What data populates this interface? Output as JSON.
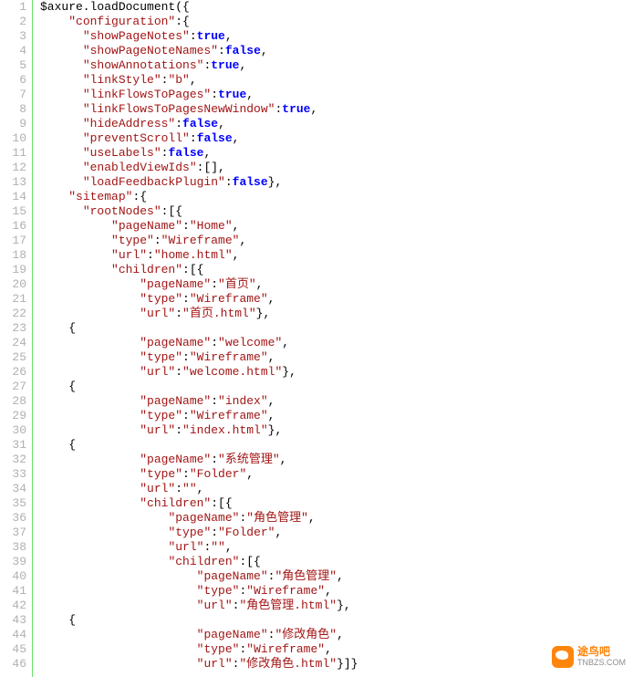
{
  "lineCount": 46,
  "code": [
    [
      [
        "plain",
        "$axure.loadDocument"
      ],
      [
        "punc",
        "({"
      ]
    ],
    [
      [
        "plain",
        "    "
      ],
      [
        "key",
        "\"configuration\""
      ],
      [
        "punc",
        ":{"
      ]
    ],
    [
      [
        "plain",
        "      "
      ],
      [
        "key",
        "\"showPageNotes\""
      ],
      [
        "punc",
        ":"
      ],
      [
        "bool",
        "true"
      ],
      [
        "punc",
        ","
      ]
    ],
    [
      [
        "plain",
        "      "
      ],
      [
        "key",
        "\"showPageNoteNames\""
      ],
      [
        "punc",
        ":"
      ],
      [
        "bool",
        "false"
      ],
      [
        "punc",
        ","
      ]
    ],
    [
      [
        "plain",
        "      "
      ],
      [
        "key",
        "\"showAnnotations\""
      ],
      [
        "punc",
        ":"
      ],
      [
        "bool",
        "true"
      ],
      [
        "punc",
        ","
      ]
    ],
    [
      [
        "plain",
        "      "
      ],
      [
        "key",
        "\"linkStyle\""
      ],
      [
        "punc",
        ":"
      ],
      [
        "str",
        "\"b\""
      ],
      [
        "punc",
        ","
      ]
    ],
    [
      [
        "plain",
        "      "
      ],
      [
        "key",
        "\"linkFlowsToPages\""
      ],
      [
        "punc",
        ":"
      ],
      [
        "bool",
        "true"
      ],
      [
        "punc",
        ","
      ]
    ],
    [
      [
        "plain",
        "      "
      ],
      [
        "key",
        "\"linkFlowsToPagesNewWindow\""
      ],
      [
        "punc",
        ":"
      ],
      [
        "bool",
        "true"
      ],
      [
        "punc",
        ","
      ]
    ],
    [
      [
        "plain",
        "      "
      ],
      [
        "key",
        "\"hideAddress\""
      ],
      [
        "punc",
        ":"
      ],
      [
        "bool",
        "false"
      ],
      [
        "punc",
        ","
      ]
    ],
    [
      [
        "plain",
        "      "
      ],
      [
        "key",
        "\"preventScroll\""
      ],
      [
        "punc",
        ":"
      ],
      [
        "bool",
        "false"
      ],
      [
        "punc",
        ","
      ]
    ],
    [
      [
        "plain",
        "      "
      ],
      [
        "key",
        "\"useLabels\""
      ],
      [
        "punc",
        ":"
      ],
      [
        "bool",
        "false"
      ],
      [
        "punc",
        ","
      ]
    ],
    [
      [
        "plain",
        "      "
      ],
      [
        "key",
        "\"enabledViewIds\""
      ],
      [
        "punc",
        ":[],"
      ]
    ],
    [
      [
        "plain",
        "      "
      ],
      [
        "key",
        "\"loadFeedbackPlugin\""
      ],
      [
        "punc",
        ":"
      ],
      [
        "bool",
        "false"
      ],
      [
        "punc",
        "},"
      ]
    ],
    [
      [
        "plain",
        "    "
      ],
      [
        "key",
        "\"sitemap\""
      ],
      [
        "punc",
        ":{"
      ]
    ],
    [
      [
        "plain",
        "      "
      ],
      [
        "key",
        "\"rootNodes\""
      ],
      [
        "punc",
        ":[{"
      ]
    ],
    [
      [
        "plain",
        "          "
      ],
      [
        "key",
        "\"pageName\""
      ],
      [
        "punc",
        ":"
      ],
      [
        "str",
        "\"Home\""
      ],
      [
        "punc",
        ","
      ]
    ],
    [
      [
        "plain",
        "          "
      ],
      [
        "key",
        "\"type\""
      ],
      [
        "punc",
        ":"
      ],
      [
        "str",
        "\"Wireframe\""
      ],
      [
        "punc",
        ","
      ]
    ],
    [
      [
        "plain",
        "          "
      ],
      [
        "key",
        "\"url\""
      ],
      [
        "punc",
        ":"
      ],
      [
        "str",
        "\"home.html\""
      ],
      [
        "punc",
        ","
      ]
    ],
    [
      [
        "plain",
        "          "
      ],
      [
        "key",
        "\"children\""
      ],
      [
        "punc",
        ":[{"
      ]
    ],
    [
      [
        "plain",
        "              "
      ],
      [
        "key",
        "\"pageName\""
      ],
      [
        "punc",
        ":"
      ],
      [
        "str",
        "\"首页\""
      ],
      [
        "punc",
        ","
      ]
    ],
    [
      [
        "plain",
        "              "
      ],
      [
        "key",
        "\"type\""
      ],
      [
        "punc",
        ":"
      ],
      [
        "str",
        "\"Wireframe\""
      ],
      [
        "punc",
        ","
      ]
    ],
    [
      [
        "plain",
        "              "
      ],
      [
        "key",
        "\"url\""
      ],
      [
        "punc",
        ":"
      ],
      [
        "str",
        "\"首页.html\""
      ],
      [
        "punc",
        "},"
      ]
    ],
    [
      [
        "plain",
        "    {"
      ]
    ],
    [
      [
        "plain",
        "              "
      ],
      [
        "key",
        "\"pageName\""
      ],
      [
        "punc",
        ":"
      ],
      [
        "str",
        "\"welcome\""
      ],
      [
        "punc",
        ","
      ]
    ],
    [
      [
        "plain",
        "              "
      ],
      [
        "key",
        "\"type\""
      ],
      [
        "punc",
        ":"
      ],
      [
        "str",
        "\"Wireframe\""
      ],
      [
        "punc",
        ","
      ]
    ],
    [
      [
        "plain",
        "              "
      ],
      [
        "key",
        "\"url\""
      ],
      [
        "punc",
        ":"
      ],
      [
        "str",
        "\"welcome.html\""
      ],
      [
        "punc",
        "},"
      ]
    ],
    [
      [
        "plain",
        "    {"
      ]
    ],
    [
      [
        "plain",
        "              "
      ],
      [
        "key",
        "\"pageName\""
      ],
      [
        "punc",
        ":"
      ],
      [
        "str",
        "\"index\""
      ],
      [
        "punc",
        ","
      ]
    ],
    [
      [
        "plain",
        "              "
      ],
      [
        "key",
        "\"type\""
      ],
      [
        "punc",
        ":"
      ],
      [
        "str",
        "\"Wireframe\""
      ],
      [
        "punc",
        ","
      ]
    ],
    [
      [
        "plain",
        "              "
      ],
      [
        "key",
        "\"url\""
      ],
      [
        "punc",
        ":"
      ],
      [
        "str",
        "\"index.html\""
      ],
      [
        "punc",
        "},"
      ]
    ],
    [
      [
        "plain",
        "    {"
      ]
    ],
    [
      [
        "plain",
        "              "
      ],
      [
        "key",
        "\"pageName\""
      ],
      [
        "punc",
        ":"
      ],
      [
        "str",
        "\"系统管理\""
      ],
      [
        "punc",
        ","
      ]
    ],
    [
      [
        "plain",
        "              "
      ],
      [
        "key",
        "\"type\""
      ],
      [
        "punc",
        ":"
      ],
      [
        "str",
        "\"Folder\""
      ],
      [
        "punc",
        ","
      ]
    ],
    [
      [
        "plain",
        "              "
      ],
      [
        "key",
        "\"url\""
      ],
      [
        "punc",
        ":"
      ],
      [
        "str",
        "\"\""
      ],
      [
        "punc",
        ","
      ]
    ],
    [
      [
        "plain",
        "              "
      ],
      [
        "key",
        "\"children\""
      ],
      [
        "punc",
        ":[{"
      ]
    ],
    [
      [
        "plain",
        "                  "
      ],
      [
        "key",
        "\"pageName\""
      ],
      [
        "punc",
        ":"
      ],
      [
        "str",
        "\"角色管理\""
      ],
      [
        "punc",
        ","
      ]
    ],
    [
      [
        "plain",
        "                  "
      ],
      [
        "key",
        "\"type\""
      ],
      [
        "punc",
        ":"
      ],
      [
        "str",
        "\"Folder\""
      ],
      [
        "punc",
        ","
      ]
    ],
    [
      [
        "plain",
        "                  "
      ],
      [
        "key",
        "\"url\""
      ],
      [
        "punc",
        ":"
      ],
      [
        "str",
        "\"\""
      ],
      [
        "punc",
        ","
      ]
    ],
    [
      [
        "plain",
        "                  "
      ],
      [
        "key",
        "\"children\""
      ],
      [
        "punc",
        ":[{"
      ]
    ],
    [
      [
        "plain",
        "                      "
      ],
      [
        "key",
        "\"pageName\""
      ],
      [
        "punc",
        ":"
      ],
      [
        "str",
        "\"角色管理\""
      ],
      [
        "punc",
        ","
      ]
    ],
    [
      [
        "plain",
        "                      "
      ],
      [
        "key",
        "\"type\""
      ],
      [
        "punc",
        ":"
      ],
      [
        "str",
        "\"Wireframe\""
      ],
      [
        "punc",
        ","
      ]
    ],
    [
      [
        "plain",
        "                      "
      ],
      [
        "key",
        "\"url\""
      ],
      [
        "punc",
        ":"
      ],
      [
        "str",
        "\"角色管理.html\""
      ],
      [
        "punc",
        "},"
      ]
    ],
    [
      [
        "plain",
        "    {"
      ]
    ],
    [
      [
        "plain",
        "                      "
      ],
      [
        "key",
        "\"pageName\""
      ],
      [
        "punc",
        ":"
      ],
      [
        "str",
        "\"修改角色\""
      ],
      [
        "punc",
        ","
      ]
    ],
    [
      [
        "plain",
        "                      "
      ],
      [
        "key",
        "\"type\""
      ],
      [
        "punc",
        ":"
      ],
      [
        "str",
        "\"Wireframe\""
      ],
      [
        "punc",
        ","
      ]
    ],
    [
      [
        "plain",
        "                      "
      ],
      [
        "key",
        "\"url\""
      ],
      [
        "punc",
        ":"
      ],
      [
        "str",
        "\"修改角色.html\""
      ],
      [
        "punc",
        "}]}"
      ]
    ]
  ],
  "watermark": {
    "name": "途鸟吧",
    "url": "TNBZS.COM"
  }
}
